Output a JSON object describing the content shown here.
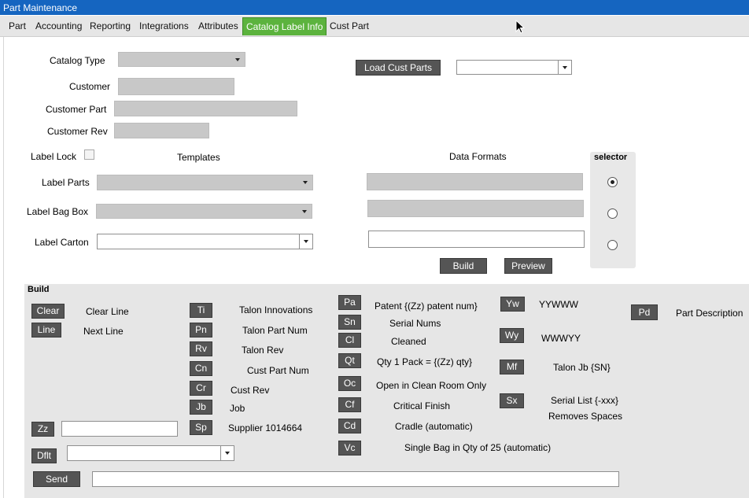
{
  "window": {
    "title": "Part Maintenance"
  },
  "tabs": [
    {
      "label": "Part"
    },
    {
      "label": "Accounting"
    },
    {
      "label": "Reporting"
    },
    {
      "label": "Integrations"
    },
    {
      "label": "Attributes"
    },
    {
      "label": "Catalog Label Info",
      "active": true
    },
    {
      "label": "Cust Part"
    }
  ],
  "form": {
    "catalog_type_label": "Catalog Type",
    "catalog_type_value": "",
    "customer_label": "Customer",
    "customer_value": "",
    "customer_part_label": "Customer Part",
    "customer_part_value": "",
    "customer_rev_label": "Customer Rev",
    "customer_rev_value": "",
    "load_cust_parts_label": "Load Cust Parts",
    "load_cust_parts_select": "",
    "label_lock_label": "Label Lock",
    "label_lock_checked": false,
    "templates_header": "Templates",
    "data_formats_header": "Data Formats",
    "selector_header": "selector",
    "label_parts_label": "Label Parts",
    "label_bag_box_label": "Label Bag Box",
    "label_carton_label": "Label Carton",
    "label_parts_template": "",
    "label_bag_box_template": "",
    "label_carton_template": "",
    "label_parts_format": "",
    "label_bag_box_format": "",
    "label_carton_format": "",
    "selected_row": 0,
    "build_button": "Build",
    "preview_button": "Preview"
  },
  "build": {
    "header": "Build",
    "clear": {
      "code": "Clear",
      "desc": "Clear Line"
    },
    "line": {
      "code": "Line",
      "desc": "Next Line"
    },
    "zz": {
      "code": "Zz",
      "value": ""
    },
    "dflt": {
      "code": "Dflt",
      "value": ""
    },
    "send": {
      "code": "Send",
      "value": ""
    },
    "col1": [
      {
        "code": "Ti",
        "desc": "Talon Innovations"
      },
      {
        "code": "Pn",
        "desc": "Talon Part Num"
      },
      {
        "code": "Rv",
        "desc": "Talon Rev"
      },
      {
        "code": "Cn",
        "desc": "Cust Part Num"
      },
      {
        "code": "Cr",
        "desc": "Cust Rev"
      },
      {
        "code": "Jb",
        "desc": "Job"
      },
      {
        "code": "Sp",
        "desc": "Supplier 1014664"
      }
    ],
    "col2": [
      {
        "code": "Pa",
        "desc": "Patent {(Zz) patent num}"
      },
      {
        "code": "Sn",
        "desc": "Serial Nums"
      },
      {
        "code": "Cl",
        "desc": "Cleaned"
      },
      {
        "code": "Qt",
        "desc": "Qty 1 Pack = {(Zz) qty}"
      },
      {
        "code": "Oc",
        "desc": "Open in Clean Room Only"
      },
      {
        "code": "Cf",
        "desc": "Critical Finish"
      },
      {
        "code": "Cd",
        "desc": "Cradle (automatic)"
      },
      {
        "code": "Vc",
        "desc": "Single Bag in Qty of 25 (automatic)"
      }
    ],
    "col3": [
      {
        "code": "Yw",
        "desc": "YYWWW"
      },
      {
        "code": "Wy",
        "desc": "WWWYY"
      },
      {
        "code": "Mf",
        "desc": "Talon Jb {SN}"
      },
      {
        "code": "Sx",
        "desc": "Serial List {-xxx}",
        "desc2": "Removes Spaces"
      }
    ],
    "col4": [
      {
        "code": "Pd",
        "desc": "Part Description"
      }
    ]
  },
  "icons": {
    "cursor": "mouse-pointer-icon",
    "dropdown": "chevron-down-icon"
  },
  "colors": {
    "title_bar": "#1565c0",
    "active_tab": "#5cb33e",
    "button": "#555555",
    "field_disabled": "#c8c8c8"
  }
}
